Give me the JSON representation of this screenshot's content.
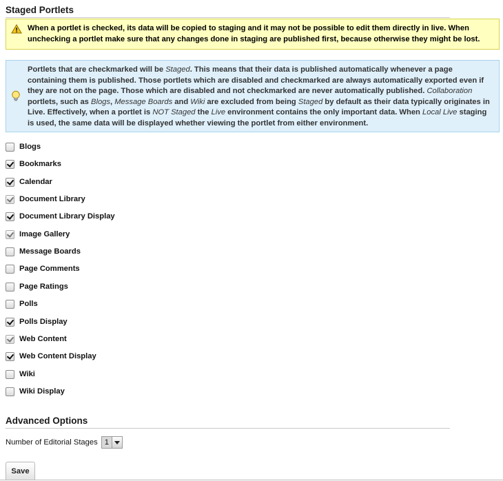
{
  "staged_portlets": {
    "title": "Staged Portlets",
    "warning": {
      "icon": "warning-icon",
      "text": "When a portlet is checked, its data will be copied to staging and it may not be possible to edit them directly in live. When unchecking a portlet make sure that any changes done in staging are published first, because otherwise they might be lost."
    },
    "info": {
      "icon": "lightbulb-icon",
      "p1": "Portlets that are checkmarked will be ",
      "p2": "Staged",
      "p3": ". This means that their data is published automatically whenever a page containing them is published. Those portlets which are disabled and checkmarked are always automatically exported even if they are not on the page. Those which are disabled and not checkmarked are never automatically published. ",
      "p4": "Collaboration",
      "p5": " portlets, such as ",
      "p6": "Blogs",
      "p7": ", ",
      "p8": "Message Boards",
      "p9": " and ",
      "p10": "Wiki",
      "p11": " are excluded from being ",
      "p12": "Staged",
      "p13": " by default as their data typically originates in Live. Effectively, when a portlet is ",
      "p14": "NOT Staged",
      "p15": " the ",
      "p16": "Live",
      "p17": " environment contains the only important data. When ",
      "p18": "Local Live",
      "p19": " staging is used, the same data will be displayed whether viewing the portlet from either environment."
    },
    "portlets": [
      {
        "label": "Blogs",
        "checked": false,
        "disabled": false
      },
      {
        "label": "Bookmarks",
        "checked": true,
        "disabled": false
      },
      {
        "label": "Calendar",
        "checked": true,
        "disabled": false
      },
      {
        "label": "Document Library",
        "checked": true,
        "disabled": true
      },
      {
        "label": "Document Library Display",
        "checked": true,
        "disabled": false
      },
      {
        "label": "Image Gallery",
        "checked": true,
        "disabled": true
      },
      {
        "label": "Message Boards",
        "checked": false,
        "disabled": false
      },
      {
        "label": "Page Comments",
        "checked": false,
        "disabled": false
      },
      {
        "label": "Page Ratings",
        "checked": false,
        "disabled": false
      },
      {
        "label": "Polls",
        "checked": false,
        "disabled": false
      },
      {
        "label": "Polls Display",
        "checked": true,
        "disabled": false
      },
      {
        "label": "Web Content",
        "checked": true,
        "disabled": true
      },
      {
        "label": "Web Content Display",
        "checked": true,
        "disabled": false
      },
      {
        "label": "Wiki",
        "checked": false,
        "disabled": false
      },
      {
        "label": "Wiki Display",
        "checked": false,
        "disabled": false
      }
    ]
  },
  "advanced_options": {
    "title": "Advanced Options",
    "editorial_stages_label": "Number of Editorial Stages",
    "editorial_stages_value": "1"
  },
  "actions": {
    "save_label": "Save"
  }
}
